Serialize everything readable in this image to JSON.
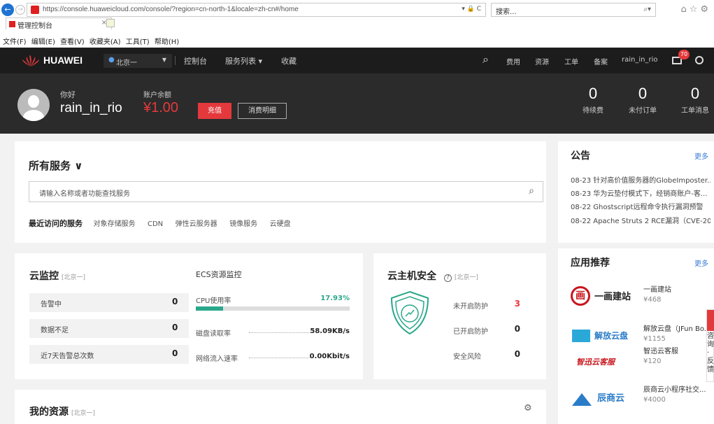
{
  "browser": {
    "url": "https://console.huaweicloud.com/console/?region=cn-north-1&locale=zh-cn#/home",
    "url_icons": "▾ 🔒 C",
    "search_placeholder": "搜索...",
    "tab_title": "管理控制台",
    "menu": [
      "文件(F)",
      "编辑(E)",
      "查看(V)",
      "收藏夹(A)",
      "工具(T)",
      "帮助(H)"
    ]
  },
  "topnav": {
    "brand": "HUAWEI",
    "region": "北京一",
    "items": [
      "控制台",
      "服务列表 ▾",
      "收藏"
    ],
    "right": [
      "费用",
      "资源",
      "工单",
      "备案",
      "rain_in_rio"
    ],
    "badge": "70"
  },
  "account": {
    "greeting": "你好",
    "username": "rain_in_rio",
    "balance_label": "账户余额",
    "balance": "¥1.00",
    "recharge": "充值",
    "detail": "消费明细",
    "counters": [
      {
        "value": "0",
        "label": "待续费"
      },
      {
        "value": "0",
        "label": "未付订单"
      },
      {
        "value": "0",
        "label": "工单消息"
      }
    ]
  },
  "services": {
    "title": "所有服务 ∨",
    "search_placeholder": "请输入名称或者功能查找服务",
    "recent_label": "最近访问的服务",
    "recent": [
      "对象存储服务",
      "CDN",
      "弹性云服务器",
      "镜像服务",
      "云硬盘"
    ]
  },
  "monitor": {
    "title": "云监控",
    "region": "[北京一]",
    "rows": [
      {
        "label": "告警中",
        "value": "0"
      },
      {
        "label": "数据不足",
        "value": "0"
      },
      {
        "label": "近7天告警总次数",
        "value": "0"
      }
    ],
    "ecs_title": "ECS资源监控",
    "cpu_label": "CPU使用率",
    "cpu_value": "17.93%",
    "cpu_fraction": 0.1793,
    "disk_label": "磁盘读取率",
    "disk_value": "58.09KB/s",
    "net_label": "网络流入速率",
    "net_value": "0.00Kbit/s"
  },
  "security": {
    "title": "云主机安全",
    "help": "?",
    "region": "[北京一]",
    "rows": [
      {
        "label": "未开启防护",
        "value": "3"
      },
      {
        "label": "已开启防护",
        "value": "0"
      },
      {
        "label": "安全风险",
        "value": "0"
      }
    ]
  },
  "resources": {
    "title": "我的资源",
    "region": "[北京一]"
  },
  "announcements": {
    "title": "公告",
    "more": "更多",
    "items": [
      "08-23  针对高价值服务器的GlobeImposter...",
      "08-23  华为云垫付模式下，经销商账户-客...",
      "08-22  Ghostscript远程命令执行漏洞预警",
      "08-22  Apache Struts 2 RCE漏洞（CVE-20..."
    ]
  },
  "apps": {
    "title": "应用推荐",
    "more": "更多",
    "items": [
      {
        "logo": "一画建站",
        "name": "一画建站",
        "price": "¥468"
      },
      {
        "logo": "解放云盘",
        "name": "解放云盘（JFun Bo...",
        "price": "¥1155"
      },
      {
        "logo": "智迅云客服",
        "name": "智迅云客服",
        "price": "¥120"
      },
      {
        "logo": "辰商云",
        "name": "辰商云小程序社交...",
        "price": "¥4000"
      }
    ]
  },
  "float": {
    "text": "咨询·反馈"
  }
}
